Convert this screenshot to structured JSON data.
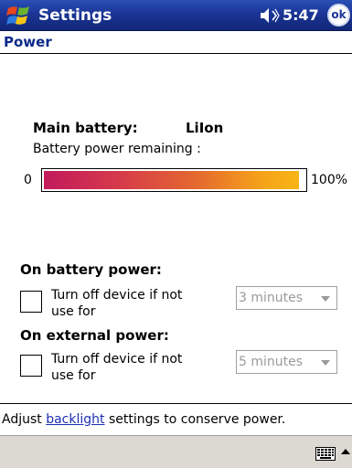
{
  "titlebar": {
    "app_title": "Settings",
    "time": "5:47",
    "ok_label": "ok"
  },
  "page": {
    "title": "Power"
  },
  "battery": {
    "main_label": "Main battery:",
    "type": "LiIon",
    "remaining_label": "Battery power remaining :",
    "scale_min": "0",
    "scale_max": "100%",
    "level_fraction": 0.98,
    "gradient_colors": [
      "#c21a5c",
      "#e4692f",
      "#f8b514"
    ]
  },
  "on_battery": {
    "heading": "On battery power:",
    "checkbox_label": "Turn off device if not use for",
    "checked": false,
    "timeout": "3 minutes"
  },
  "on_external": {
    "heading": "On external power:",
    "checkbox_label": "Turn off device if not use for",
    "checked": false,
    "timeout": "5 minutes"
  },
  "footer": {
    "prefix": "Adjust ",
    "link": "backlight",
    "suffix": " settings to conserve power."
  },
  "menubar": {
    "input_icon": "keyboard-icon"
  },
  "colors": {
    "titlebar": "#1b3596",
    "page_title": "#0b2a8a",
    "link": "#1c2fb0",
    "menubar": "#dcd9d2"
  }
}
